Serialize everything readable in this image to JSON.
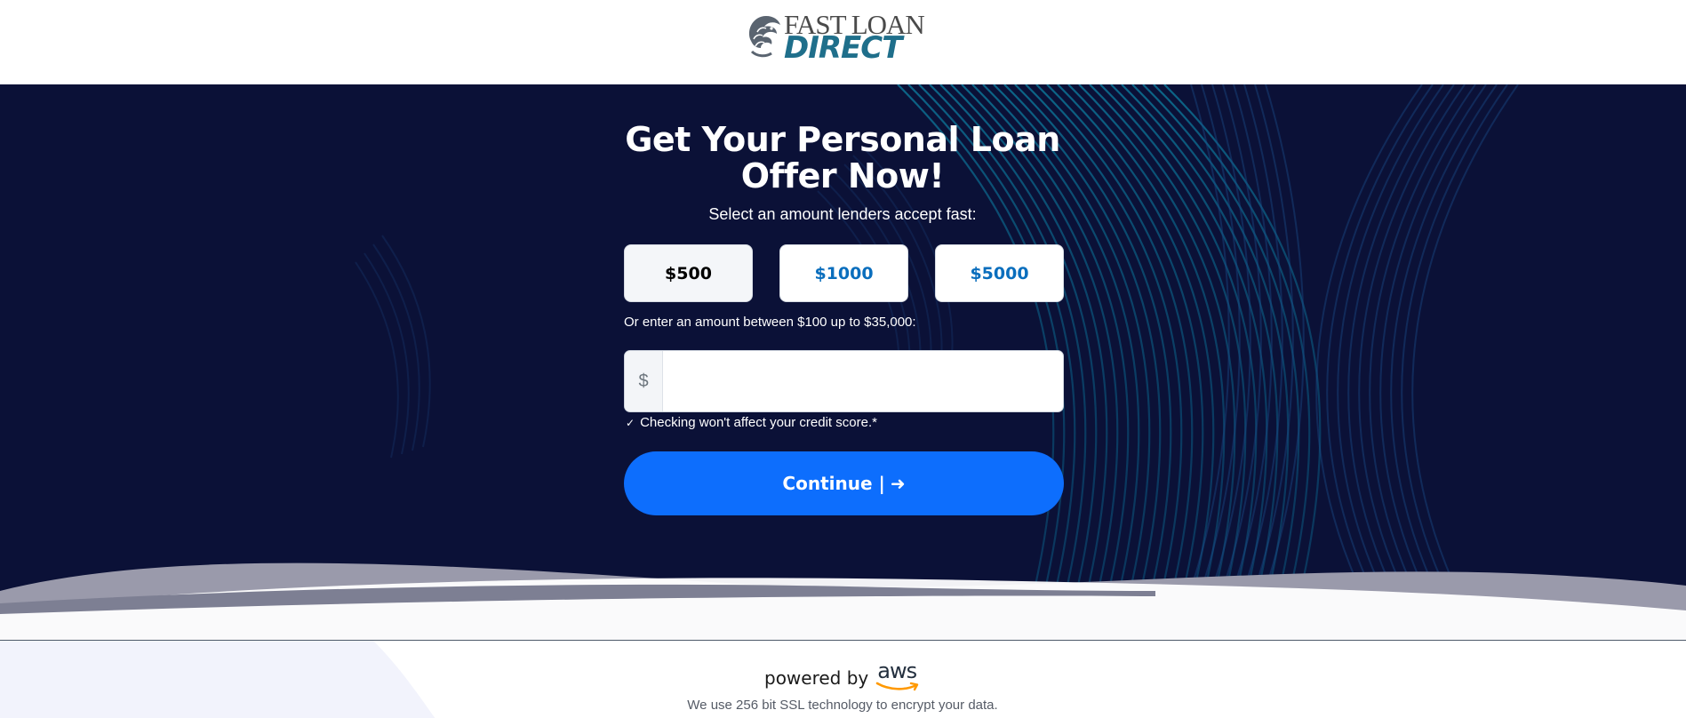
{
  "header": {
    "logo": {
      "line1": "FAST LOAN",
      "line2": "DIRECT"
    }
  },
  "hero": {
    "title": "Get Your Personal Loan Offer Now!",
    "subtitle": "Select an amount lenders accept fast:",
    "amounts": [
      {
        "label": "$500",
        "selected": true
      },
      {
        "label": "$1000",
        "selected": false
      },
      {
        "label": "$5000",
        "selected": false
      }
    ],
    "hint": "Or enter an amount between $100 up to $35,000:",
    "input": {
      "prefix": "$",
      "value": "",
      "placeholder": ""
    },
    "credit_note": "Checking won't affect your credit score.*",
    "continue_label": "Continue |",
    "continue_arrow": "➜"
  },
  "footer": {
    "powered_by": "powered by",
    "aws": "aws",
    "ssl_note": "We use 256 bit SSL technology to encrypt your data."
  },
  "colors": {
    "hero_bg": "#0b1137",
    "accent": "#0d6efd",
    "amount_text": "#0a6ebd",
    "logo_direct": "#1f6f8b",
    "aws_smile": "#ff9900"
  },
  "icons": [
    "lion-logo-icon",
    "check-icon",
    "arrow-right-icon",
    "aws-smile-icon"
  ]
}
